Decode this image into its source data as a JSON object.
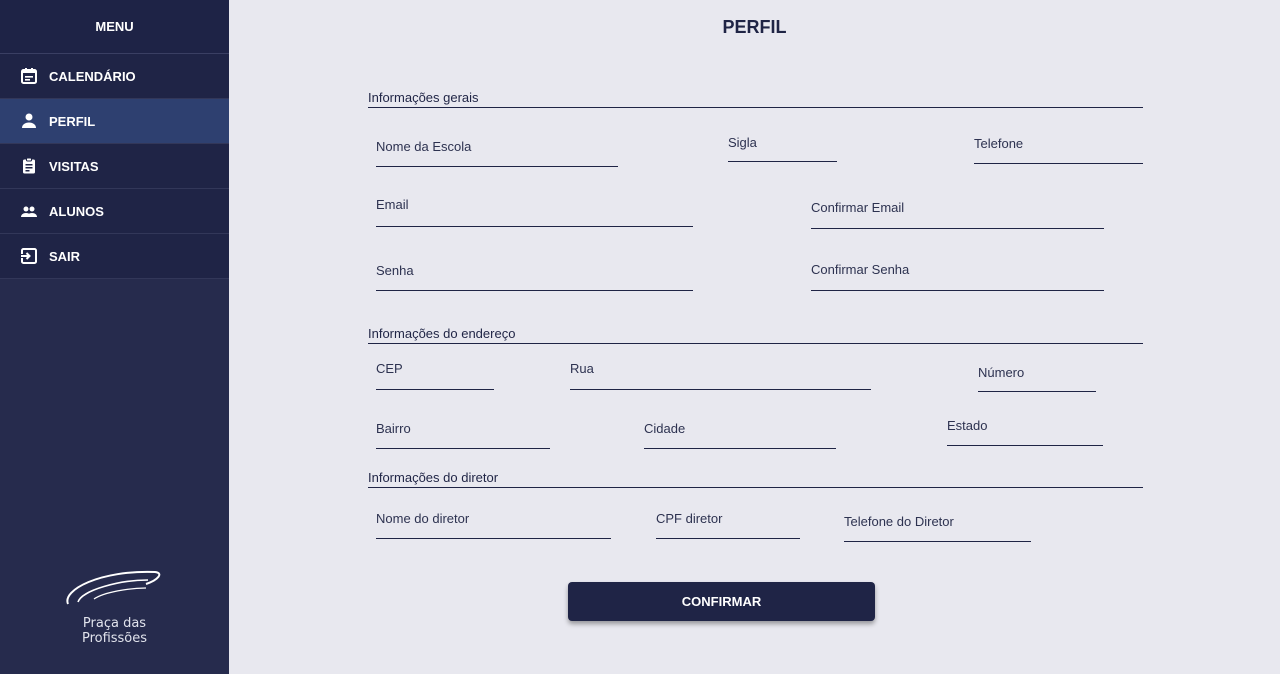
{
  "sidebar": {
    "header": "MENU",
    "items": [
      {
        "label": "CALENDÁRIO",
        "icon": "calendar-icon"
      },
      {
        "label": "PERFIL",
        "icon": "person-icon",
        "active": true
      },
      {
        "label": "VISITAS",
        "icon": "clipboard-icon"
      },
      {
        "label": "ALUNOS",
        "icon": "group-icon"
      },
      {
        "label": "SAIR",
        "icon": "logout-icon"
      }
    ],
    "logo": {
      "line1": "Praça das",
      "line2": "Profissões"
    }
  },
  "main": {
    "title": "PERFIL",
    "sections": {
      "general": "Informações gerais",
      "address": "Informações do endereço",
      "director": "Informações do diretor"
    },
    "fields": {
      "school_name": "Nome da Escola",
      "acronym": "Sigla",
      "phone": "Telefone",
      "email": "Email",
      "confirm_email": "Confirmar Email",
      "password": "Senha",
      "confirm_password": "Confirmar Senha",
      "cep": "CEP",
      "street": "Rua",
      "number": "Número",
      "neighborhood": "Bairro",
      "city": "Cidade",
      "state": "Estado",
      "director_name": "Nome do diretor",
      "director_cpf": "CPF diretor",
      "director_phone": "Telefone do Diretor"
    },
    "confirm_button": "CONFIRMAR"
  },
  "colors": {
    "sidebar_bg": "#262b4d",
    "active_item": "#2e4070",
    "accent": "#1f2446",
    "page_bg": "#e8e8ef"
  }
}
